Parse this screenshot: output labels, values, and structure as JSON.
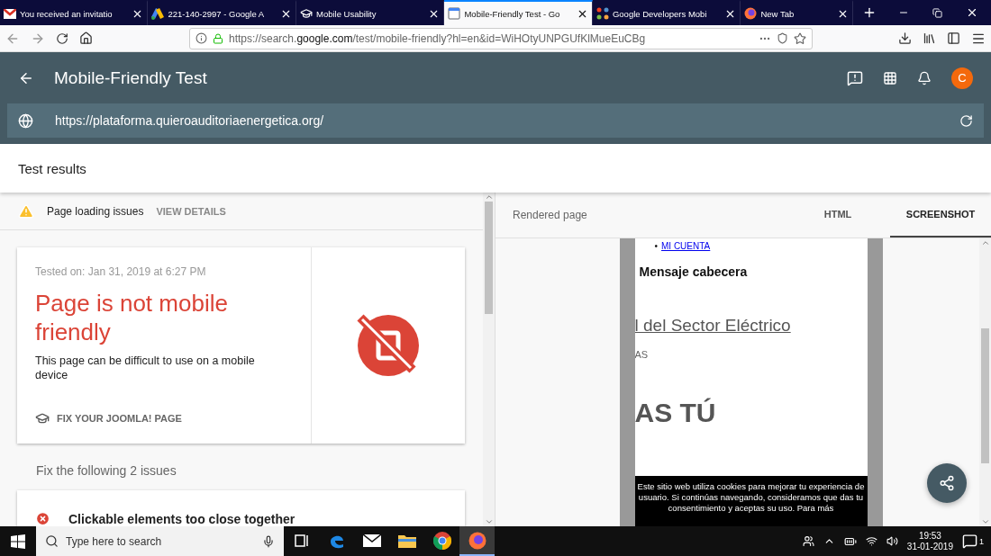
{
  "browser_tabs": [
    {
      "title": "You received an invitatio",
      "kind": "mail",
      "selected": false
    },
    {
      "title": "221-140-2997 - Google A",
      "kind": "ads",
      "selected": false
    },
    {
      "title": "Mobile Usability",
      "kind": "cap",
      "selected": false
    },
    {
      "title": "Mobile-Friendly Test - Go",
      "kind": "test",
      "selected": true
    },
    {
      "title": "Google Developers Mobi",
      "kind": "joomla",
      "selected": false
    },
    {
      "title": "New Tab",
      "kind": "firefox",
      "selected": false
    }
  ],
  "address_bar": {
    "prefix": "https://search.",
    "domain": "google.com",
    "path": "/test/mobile-friendly?hl=en&id=WiHOtyUNPGUfKlMueEuCBg"
  },
  "app_header": {
    "title": "Mobile-Friendly Test",
    "avatar": "C",
    "tested_url": "https://plataforma.quieroauditoriaenergetica.org/"
  },
  "section_title": "Test results",
  "warning": {
    "text": "Page loading issues",
    "action": "VIEW DETAILS"
  },
  "result_card": {
    "tested_on": "Tested on: Jan 31, 2019 at 6:27 PM",
    "verdict": "Page is not mobile friendly",
    "description": "This page can be difficult to use on a mobile device",
    "link": "FIX YOUR JOOMLA! PAGE"
  },
  "issues_heading": "Fix the following 2 issues",
  "issues": [
    {
      "text": "Clickable elements too close together"
    }
  ],
  "rendered_panel": {
    "title": "Rendered page",
    "tabs": [
      {
        "label": "HTML",
        "selected": false
      },
      {
        "label": "SCREENSHOT",
        "selected": true
      }
    ]
  },
  "screenshot": {
    "bullet": "•",
    "menu_link": "MI CUENTA",
    "heading": "Mensaje cabecera",
    "banner_link": "l del Sector Eléctrico",
    "subtext": "AS",
    "big_text": "AS TÚ",
    "cookie_notice": "Este sitio web utiliza cookies para mejorar tu experiencia de usuario. Si continúas navegando, consideramos que das tu consentimiento y aceptas su uso. Para más"
  },
  "taskbar": {
    "search_placeholder": "Type here to search",
    "apps": [
      {
        "kind": "taskview",
        "selected": false
      },
      {
        "kind": "edge",
        "selected": false
      },
      {
        "kind": "mail",
        "selected": false
      },
      {
        "kind": "explorer",
        "selected": false
      },
      {
        "kind": "chrome",
        "selected": false
      },
      {
        "kind": "firefox",
        "selected": true
      }
    ],
    "time": "19:53",
    "date": "31-01-2019",
    "notifications": "1"
  }
}
